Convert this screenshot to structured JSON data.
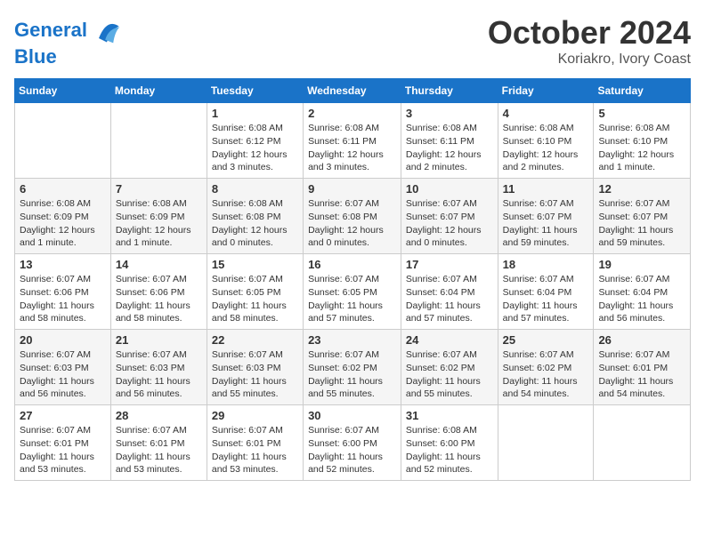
{
  "header": {
    "logo_line1": "General",
    "logo_line2": "Blue",
    "month": "October 2024",
    "location": "Koriakro, Ivory Coast"
  },
  "weekdays": [
    "Sunday",
    "Monday",
    "Tuesday",
    "Wednesday",
    "Thursday",
    "Friday",
    "Saturday"
  ],
  "weeks": [
    [
      {
        "day": "",
        "info": ""
      },
      {
        "day": "",
        "info": ""
      },
      {
        "day": "1",
        "info": "Sunrise: 6:08 AM\nSunset: 6:12 PM\nDaylight: 12 hours\nand 3 minutes."
      },
      {
        "day": "2",
        "info": "Sunrise: 6:08 AM\nSunset: 6:11 PM\nDaylight: 12 hours\nand 3 minutes."
      },
      {
        "day": "3",
        "info": "Sunrise: 6:08 AM\nSunset: 6:11 PM\nDaylight: 12 hours\nand 2 minutes."
      },
      {
        "day": "4",
        "info": "Sunrise: 6:08 AM\nSunset: 6:10 PM\nDaylight: 12 hours\nand 2 minutes."
      },
      {
        "day": "5",
        "info": "Sunrise: 6:08 AM\nSunset: 6:10 PM\nDaylight: 12 hours\nand 1 minute."
      }
    ],
    [
      {
        "day": "6",
        "info": "Sunrise: 6:08 AM\nSunset: 6:09 PM\nDaylight: 12 hours\nand 1 minute."
      },
      {
        "day": "7",
        "info": "Sunrise: 6:08 AM\nSunset: 6:09 PM\nDaylight: 12 hours\nand 1 minute."
      },
      {
        "day": "8",
        "info": "Sunrise: 6:08 AM\nSunset: 6:08 PM\nDaylight: 12 hours\nand 0 minutes."
      },
      {
        "day": "9",
        "info": "Sunrise: 6:07 AM\nSunset: 6:08 PM\nDaylight: 12 hours\nand 0 minutes."
      },
      {
        "day": "10",
        "info": "Sunrise: 6:07 AM\nSunset: 6:07 PM\nDaylight: 12 hours\nand 0 minutes."
      },
      {
        "day": "11",
        "info": "Sunrise: 6:07 AM\nSunset: 6:07 PM\nDaylight: 11 hours\nand 59 minutes."
      },
      {
        "day": "12",
        "info": "Sunrise: 6:07 AM\nSunset: 6:07 PM\nDaylight: 11 hours\nand 59 minutes."
      }
    ],
    [
      {
        "day": "13",
        "info": "Sunrise: 6:07 AM\nSunset: 6:06 PM\nDaylight: 11 hours\nand 58 minutes."
      },
      {
        "day": "14",
        "info": "Sunrise: 6:07 AM\nSunset: 6:06 PM\nDaylight: 11 hours\nand 58 minutes."
      },
      {
        "day": "15",
        "info": "Sunrise: 6:07 AM\nSunset: 6:05 PM\nDaylight: 11 hours\nand 58 minutes."
      },
      {
        "day": "16",
        "info": "Sunrise: 6:07 AM\nSunset: 6:05 PM\nDaylight: 11 hours\nand 57 minutes."
      },
      {
        "day": "17",
        "info": "Sunrise: 6:07 AM\nSunset: 6:04 PM\nDaylight: 11 hours\nand 57 minutes."
      },
      {
        "day": "18",
        "info": "Sunrise: 6:07 AM\nSunset: 6:04 PM\nDaylight: 11 hours\nand 57 minutes."
      },
      {
        "day": "19",
        "info": "Sunrise: 6:07 AM\nSunset: 6:04 PM\nDaylight: 11 hours\nand 56 minutes."
      }
    ],
    [
      {
        "day": "20",
        "info": "Sunrise: 6:07 AM\nSunset: 6:03 PM\nDaylight: 11 hours\nand 56 minutes."
      },
      {
        "day": "21",
        "info": "Sunrise: 6:07 AM\nSunset: 6:03 PM\nDaylight: 11 hours\nand 56 minutes."
      },
      {
        "day": "22",
        "info": "Sunrise: 6:07 AM\nSunset: 6:03 PM\nDaylight: 11 hours\nand 55 minutes."
      },
      {
        "day": "23",
        "info": "Sunrise: 6:07 AM\nSunset: 6:02 PM\nDaylight: 11 hours\nand 55 minutes."
      },
      {
        "day": "24",
        "info": "Sunrise: 6:07 AM\nSunset: 6:02 PM\nDaylight: 11 hours\nand 55 minutes."
      },
      {
        "day": "25",
        "info": "Sunrise: 6:07 AM\nSunset: 6:02 PM\nDaylight: 11 hours\nand 54 minutes."
      },
      {
        "day": "26",
        "info": "Sunrise: 6:07 AM\nSunset: 6:01 PM\nDaylight: 11 hours\nand 54 minutes."
      }
    ],
    [
      {
        "day": "27",
        "info": "Sunrise: 6:07 AM\nSunset: 6:01 PM\nDaylight: 11 hours\nand 53 minutes."
      },
      {
        "day": "28",
        "info": "Sunrise: 6:07 AM\nSunset: 6:01 PM\nDaylight: 11 hours\nand 53 minutes."
      },
      {
        "day": "29",
        "info": "Sunrise: 6:07 AM\nSunset: 6:01 PM\nDaylight: 11 hours\nand 53 minutes."
      },
      {
        "day": "30",
        "info": "Sunrise: 6:07 AM\nSunset: 6:00 PM\nDaylight: 11 hours\nand 52 minutes."
      },
      {
        "day": "31",
        "info": "Sunrise: 6:08 AM\nSunset: 6:00 PM\nDaylight: 11 hours\nand 52 minutes."
      },
      {
        "day": "",
        "info": ""
      },
      {
        "day": "",
        "info": ""
      }
    ]
  ]
}
